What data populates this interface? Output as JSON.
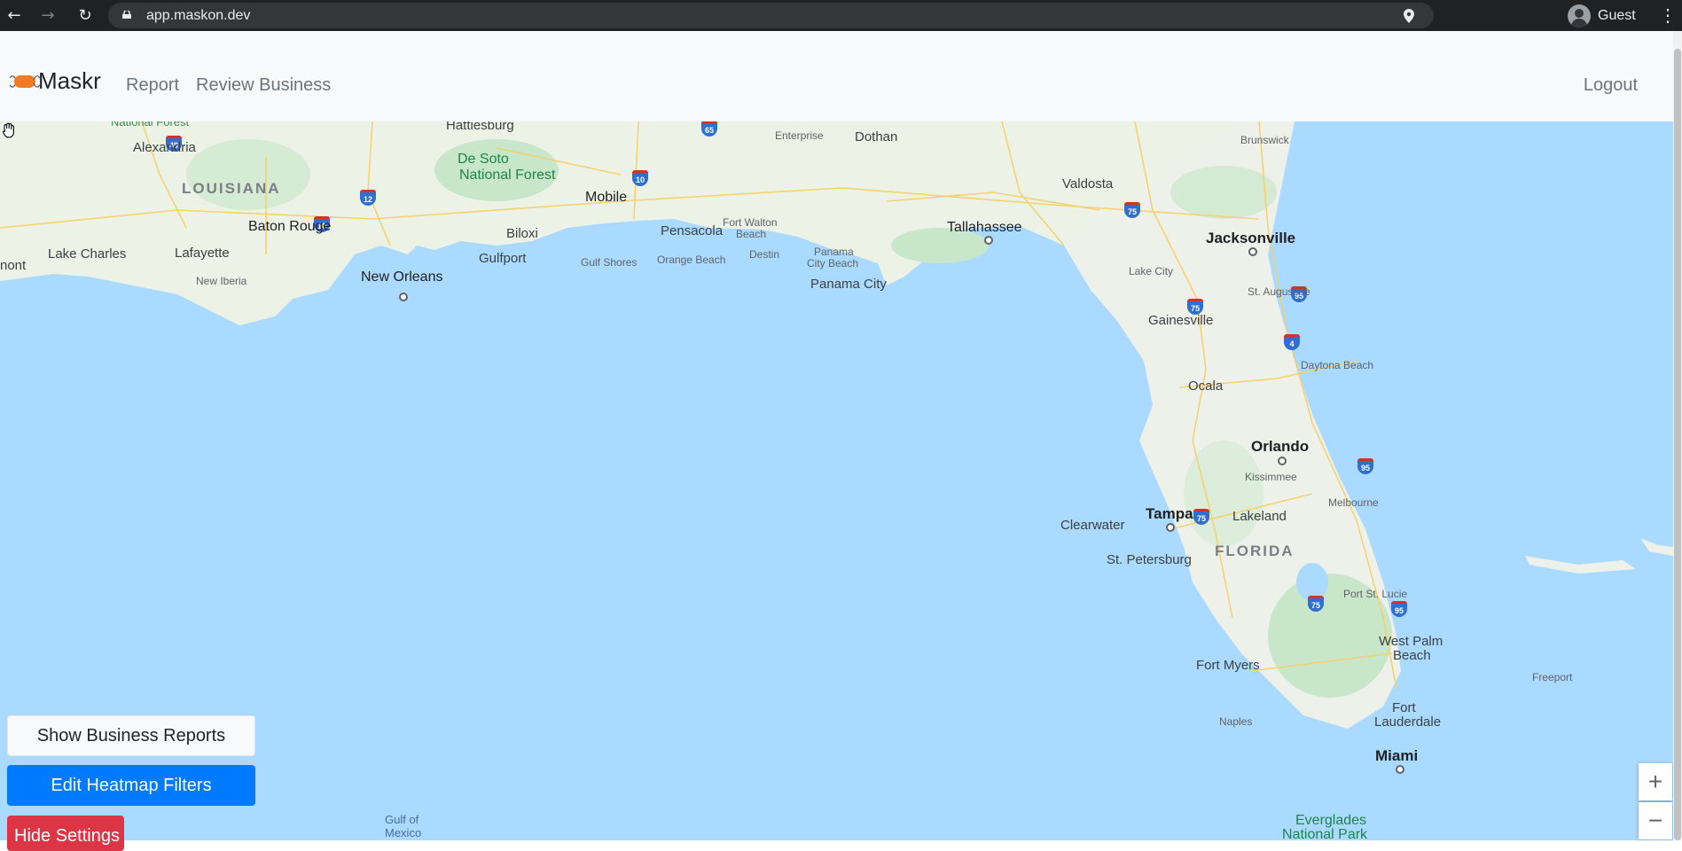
{
  "browser": {
    "url": "app.maskon.dev",
    "profile_label": "Guest",
    "icons": [
      "back-arrow-icon",
      "forward-arrow-icon",
      "reload-icon",
      "lock-icon",
      "location-pin-icon",
      "avatar-icon",
      "more-vert-icon"
    ]
  },
  "app": {
    "brand": "Maskr",
    "nav": {
      "report": "Report",
      "review_business": "Review Business",
      "logout": "Logout"
    },
    "accent_color": "#f07b23"
  },
  "map": {
    "labels": {
      "national_forest_top": "National Forest",
      "hattiesburg": "Hattiesburg",
      "enterprise": "Enterprise",
      "dothan": "Dothan",
      "brunswick": "Brunswick",
      "alexandria": "Alexandria",
      "de_soto": "De Soto",
      "de_soto_nf": "National Forest",
      "louisiana": "LOUISIANA",
      "valdosta": "Valdosta",
      "mobile": "Mobile",
      "fort_walton": "Fort Walton",
      "fort_walton_beach": "Beach",
      "tallahassee": "Tallahassee",
      "jacksonville": "Jacksonville",
      "baton_rouge": "Baton Rouge",
      "pensacola": "Pensacola",
      "biloxi": "Biloxi",
      "lake_charles": "Lake Charles",
      "lafayette": "Lafayette",
      "gulfport": "Gulfport",
      "gulf_shores": "Gulf Shores",
      "orange_beach": "Orange Beach",
      "destin": "Destin",
      "panama": "Panama",
      "city_beach": "City Beach",
      "lake_city": "Lake City",
      "nont": "nont",
      "new_iberia": "New Iberia",
      "new_orleans": "New Orleans",
      "panama_city": "Panama City",
      "st_augustine": "St. Augustine",
      "gainesville": "Gainesville",
      "daytona_beach": "Daytona Beach",
      "ocala": "Ocala",
      "orlando": "Orlando",
      "kissimmee": "Kissimmee",
      "melbourne": "Melbourne",
      "tampa": "Tampa",
      "clearwater": "Clearwater",
      "lakeland": "Lakeland",
      "st_petersburg": "St. Petersburg",
      "florida": "FLORIDA",
      "port_st_lucie": "Port St. Lucie",
      "west_palm": "West Palm",
      "west_palm_beach": "Beach",
      "fort_myers": "Fort Myers",
      "freeport": "Freeport",
      "fort": "Fort",
      "lauderdale": "Lauderdale",
      "naples": "Naples",
      "miami": "Miami",
      "gulf_of": "Gulf of",
      "mexico": "Mexico",
      "everglades": "Everglades",
      "everglades_park": "National Park"
    },
    "shields": [
      "65",
      "49",
      "12",
      "10",
      "10",
      "75",
      "95",
      "75",
      "4",
      "95",
      "75",
      "75",
      "95"
    ],
    "zoom_in": "+",
    "zoom_out": "−"
  },
  "controls": {
    "show_business_reports": "Show Business Reports",
    "edit_heatmap_filters": "Edit Heatmap Filters",
    "hide_settings": "Hide Settings"
  }
}
